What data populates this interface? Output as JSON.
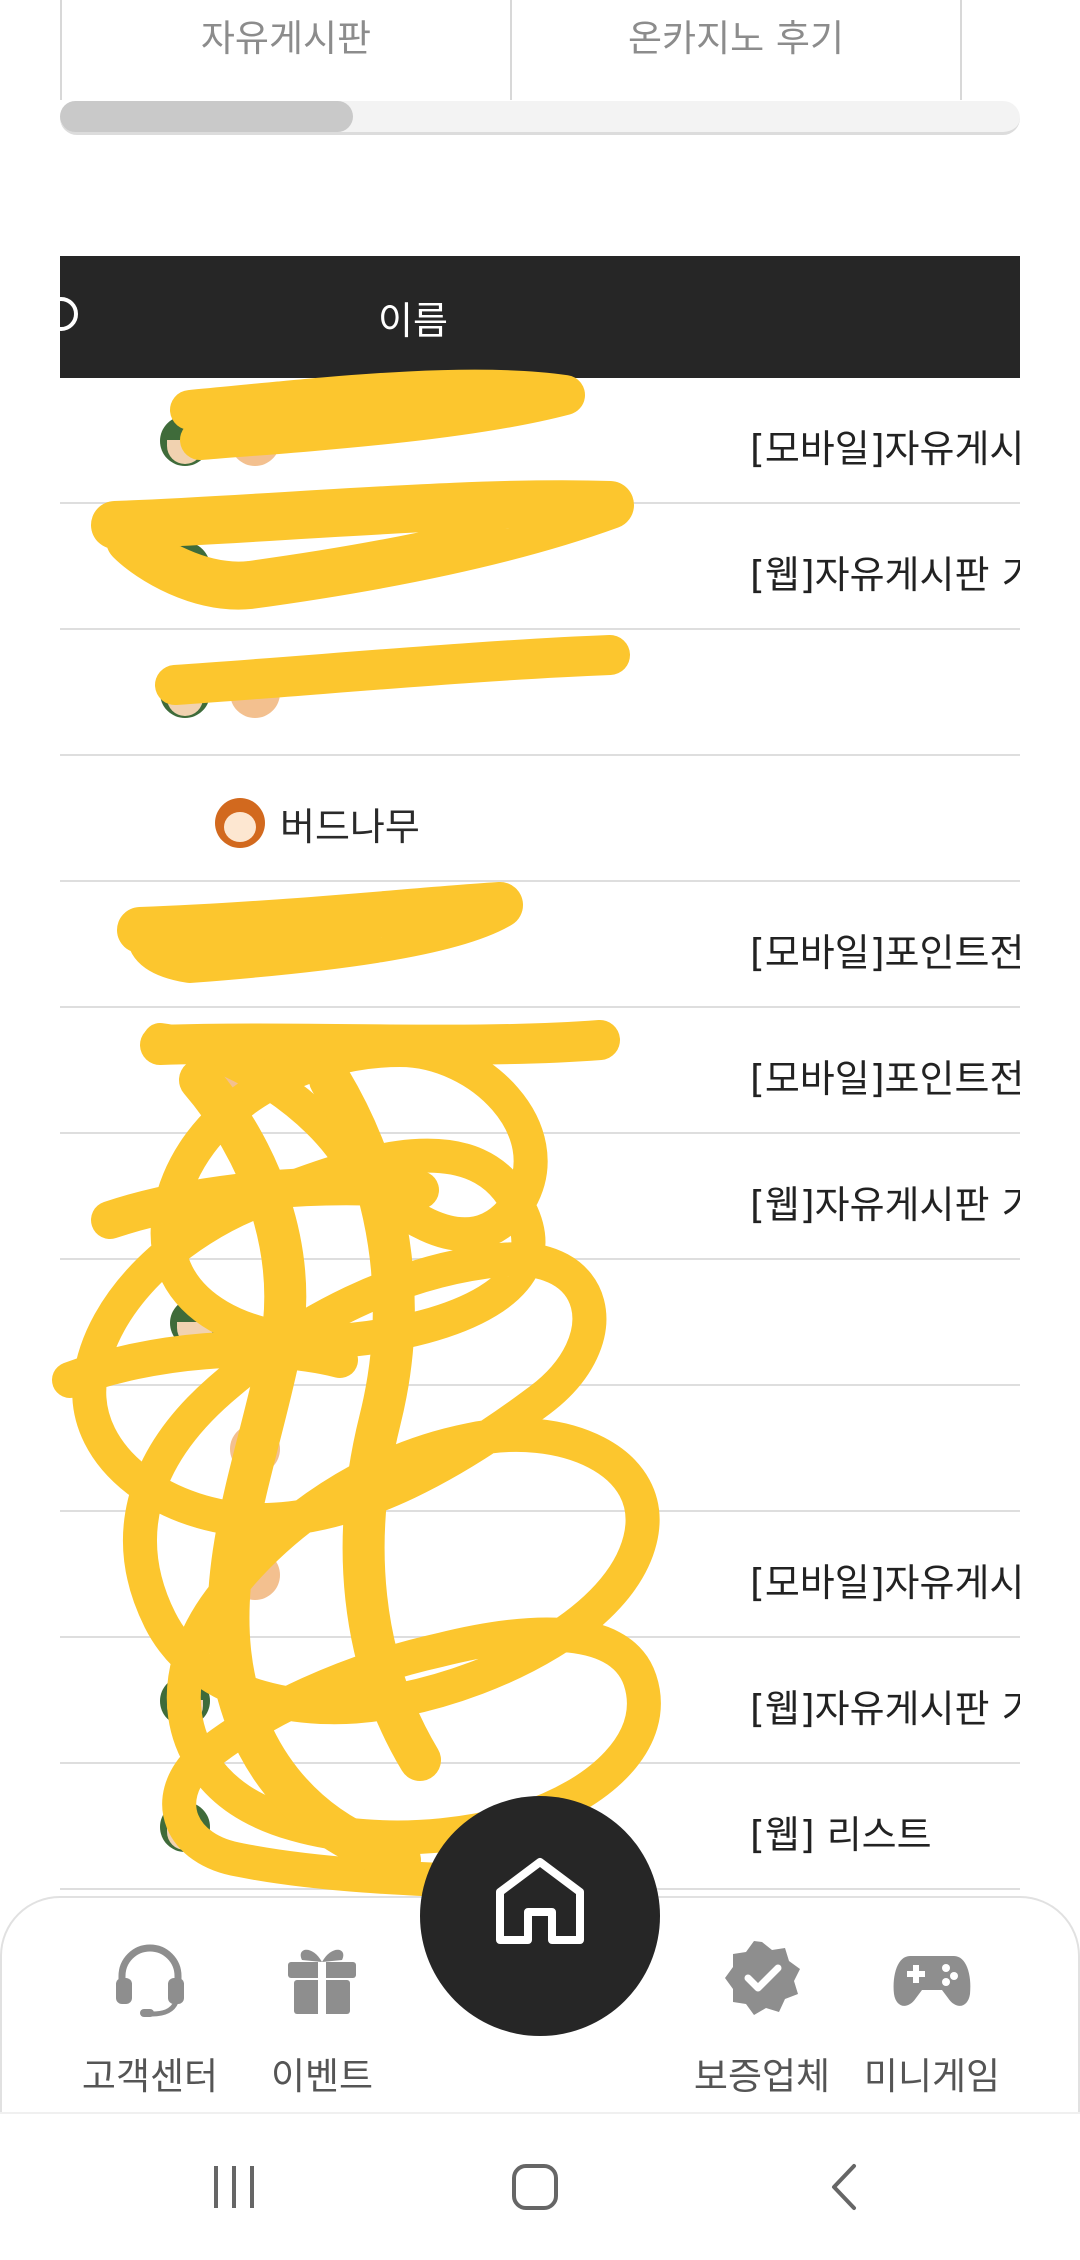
{
  "tabs": [
    {
      "label": "자유게시판"
    },
    {
      "label": "온카지노 후기"
    }
  ],
  "table": {
    "header_name": "이름",
    "rows": [
      {
        "name": "",
        "category": "[모바일]자유게시"
      },
      {
        "name": "",
        "category": "[웹]자유게시판 기"
      },
      {
        "name": "",
        "category": ""
      },
      {
        "name": "버드나무",
        "category": ""
      },
      {
        "name": "",
        "category": "[모바일]포인트전"
      },
      {
        "name": "",
        "category": "[모바일]포인트전"
      },
      {
        "name": "",
        "category": "[웹]자유게시판 기"
      },
      {
        "name": "",
        "category": ""
      },
      {
        "name": "",
        "category": ""
      },
      {
        "name": "",
        "category": "[모바일]자유게시"
      },
      {
        "name": "",
        "category": "[웹]자유게시판 기"
      },
      {
        "name": "",
        "category": "[웹] 리스트"
      }
    ]
  },
  "bottom_nav": {
    "customer_center": "고객센터",
    "event": "이벤트",
    "verified": "보증업체",
    "minigame": "미니게임"
  },
  "colors": {
    "header_bg": "#262626",
    "scribble": "#fcc62e",
    "icon_gray": "#8e8e8e"
  }
}
